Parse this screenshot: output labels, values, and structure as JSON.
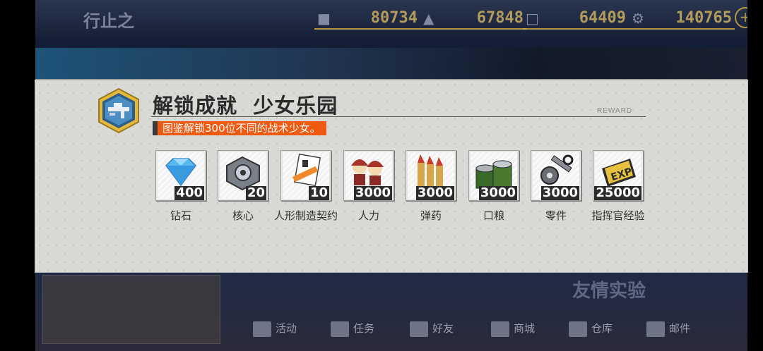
{
  "background": {
    "commander_name": "行止之",
    "resources": [
      {
        "name": "manpower",
        "value": "80734"
      },
      {
        "name": "ammo",
        "value": "67848"
      },
      {
        "name": "rations",
        "value": "64409"
      },
      {
        "name": "parts",
        "value": "140765"
      }
    ],
    "nav": [
      {
        "label": "活动"
      },
      {
        "label": "任务"
      },
      {
        "label": "好友"
      },
      {
        "label": "商城"
      },
      {
        "label": "仓库"
      },
      {
        "label": "邮件"
      }
    ],
    "banner_text": "友情实验"
  },
  "modal": {
    "title": "解锁成就  少女乐园",
    "reward_label": "REWARD",
    "description": "图鉴解锁300位不同的战术少女。",
    "items": [
      {
        "name": "钻石",
        "qty": "400",
        "icon": "diamond-icon"
      },
      {
        "name": "核心",
        "qty": "20",
        "icon": "core-icon"
      },
      {
        "name": "人形制造契约",
        "qty": "10",
        "icon": "contract-icon"
      },
      {
        "name": "人力",
        "qty": "3000",
        "icon": "manpower-icon"
      },
      {
        "name": "弹药",
        "qty": "3000",
        "icon": "ammo-icon"
      },
      {
        "name": "口粮",
        "qty": "3000",
        "icon": "rations-icon"
      },
      {
        "name": "零件",
        "qty": "3000",
        "icon": "parts-icon"
      },
      {
        "name": "指挥官经验",
        "qty": "25000",
        "icon": "exp-icon"
      }
    ]
  },
  "colors": {
    "accent": "#ee5a11",
    "gold": "#d9b447",
    "panel": "#d9d9d6"
  }
}
